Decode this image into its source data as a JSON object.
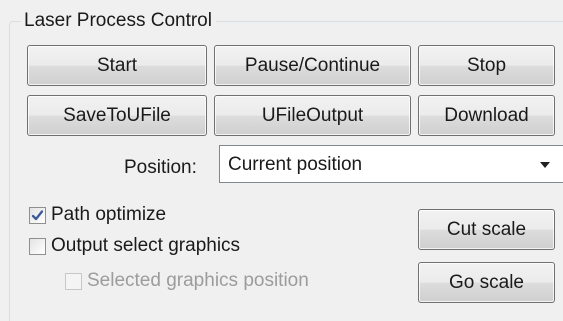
{
  "group": {
    "title": "Laser Process Control"
  },
  "buttons": {
    "start": "Start",
    "pause_continue": "Pause/Continue",
    "stop": "Stop",
    "save_to_ufile": "SaveToUFile",
    "ufile_output": "UFileOutput",
    "download": "Download",
    "cut_scale": "Cut scale",
    "go_scale": "Go scale"
  },
  "position": {
    "label": "Position:",
    "selected": "Current position"
  },
  "options": {
    "path_optimize": {
      "label": "Path optimize",
      "checked": true
    },
    "output_select_graphics": {
      "label": "Output select graphics",
      "checked": false
    },
    "selected_graphics_position": {
      "label": "Selected graphics position",
      "checked": false,
      "enabled": false
    }
  },
  "colors": {
    "background": "#f0f0f0",
    "check_mark": "#3a5a97",
    "disabled_text": "#9c9c9c"
  },
  "icons": {
    "dropdown": "chevron-down-icon",
    "check": "checkmark-icon"
  }
}
